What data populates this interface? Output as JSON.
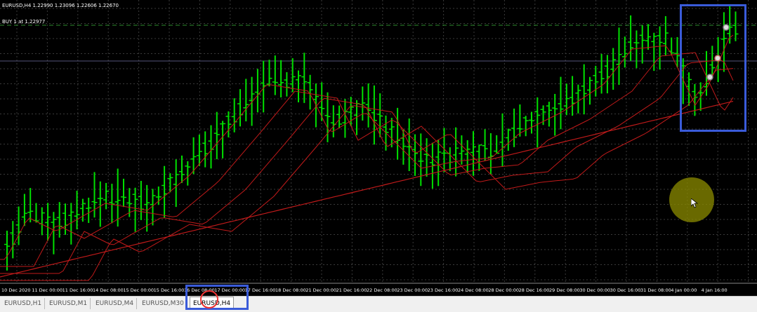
{
  "chart": {
    "header": "EURUSD,H4  1.22990 1.23096 1.22606 1.22670",
    "buy_label": "BUY 1 at 1.22977",
    "time_labels": [
      "10 Dec 2020",
      "11 Dec 00:00",
      "11 Dec 16:00",
      "14 Dec 08:00",
      "15 Dec 00:00",
      "15 Dec 16:00",
      "16 Dec 08:00",
      "17 Dec 00:00",
      "17 Dec 16:00",
      "18 Dec 08:00",
      "21 Dec 00:00",
      "21 Dec 16:00",
      "22 Dec 08:00",
      "23 Dec 00:00",
      "23 Dec 16:00",
      "24 Dec 08:00",
      "28 Dec 00:00",
      "28 Dec 16:00",
      "29 Dec 08:00",
      "30 Dec 00:00",
      "30 Dec 16:00",
      "31 Dec 08:00",
      "4 Jan 00:00",
      "4 Jan 16:00"
    ],
    "colors": {
      "background": "#000000",
      "grid": "#3a3a3a",
      "candles": "#00e000",
      "ma": "#c01a1a",
      "buy_line": "#2e8b2e",
      "price_line": "#555577"
    }
  },
  "tabs": [
    {
      "label": "EURUSD,H1"
    },
    {
      "label": "EURUSD,M1"
    },
    {
      "label": "EURUSD,M4"
    },
    {
      "label": "EURUSD,M30"
    },
    {
      "label": "EURUSD,H4"
    }
  ],
  "annotations": {
    "highlight_color": "#3a5bd9",
    "cursor_icon": "arrow-cursor-icon"
  }
}
